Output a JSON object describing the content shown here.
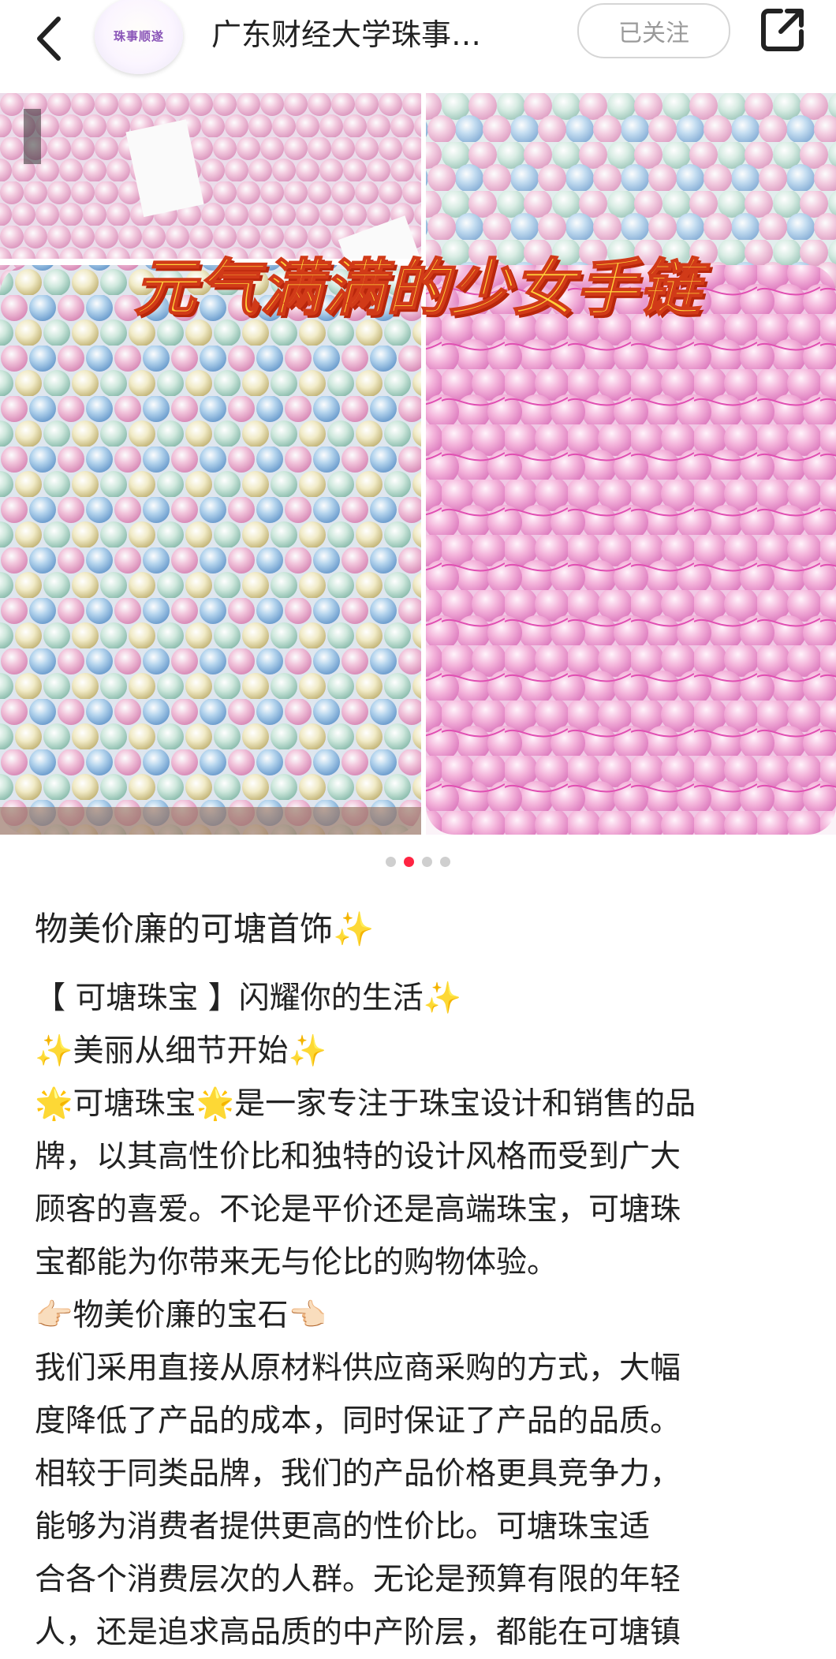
{
  "header": {
    "back_icon": "chevron-left-icon",
    "avatar_text": "珠事顺遂",
    "title": "广东财经大学珠事…",
    "follow_label": "已关注",
    "share_icon": "share-icon"
  },
  "gallery": {
    "overlay_text": "元气满满的少女手链",
    "page_count": 4,
    "active_index": 1
  },
  "post": {
    "title": "物美价廉的可塘首饰✨",
    "lines": [
      "【 可塘珠宝 】闪耀你的生活✨",
      "✨美丽从细节开始✨",
      "🌟可塘珠宝🌟是一家专注于珠宝设计和销售的品",
      "牌，以其高性价比和独特的设计风格而受到广大",
      "顾客的喜爱。不论是平价还是高端珠宝，可塘珠",
      "宝都能为你带来无与伦比的购物体验。",
      "👉🏻物美价廉的宝石👈🏻",
      "我们采用直接从原材料供应商采购的方式，大幅",
      "度降低了产品的成本，同时保证了产品的品质。",
      "相较于同类品牌，我们的产品价格更具竞争力，",
      "能够为消费者提供更高的性价比。可塘珠宝适",
      "合各个消费层次的人群。无论是预算有限的年轻",
      "人，还是追求高品质的中产阶层，都能在可塘镇"
    ]
  },
  "colors": {
    "accent": "#ff2442",
    "overlay_fill": "#ffd23a",
    "overlay_stroke": "#d13a18"
  }
}
